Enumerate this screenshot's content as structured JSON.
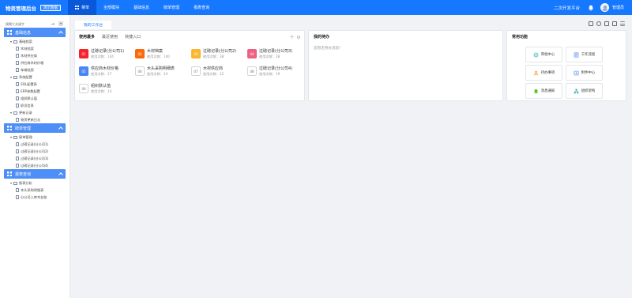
{
  "header": {
    "brand": "物资管理后台",
    "demo_tag": "演示数据",
    "nav": [
      {
        "label": "菜单",
        "active": true
      },
      {
        "label": "全部模块",
        "active": false
      },
      {
        "label": "基础信息",
        "active": false
      },
      {
        "label": "磅单管理",
        "active": false
      },
      {
        "label": "报表查询",
        "active": false
      }
    ],
    "platform_link": "二次开发平台",
    "username": "管理员"
  },
  "sidebar": {
    "search_placeholder": "模糊大关键字",
    "groups": [
      {
        "label": "基础信息",
        "nodes": [
          {
            "label": "基础档案",
            "level": 1,
            "type": "folder"
          },
          {
            "label": "木材档案",
            "level": 2,
            "type": "doc"
          },
          {
            "label": "木材供应商",
            "level": 2,
            "type": "doc"
          },
          {
            "label": "供应商木材价格",
            "level": 2,
            "type": "doc"
          },
          {
            "label": "车辆档案",
            "level": 2,
            "type": "doc"
          },
          {
            "label": "系统配置",
            "level": 1,
            "type": "folder"
          },
          {
            "label": "SQL配置表",
            "level": 2,
            "type": "doc"
          },
          {
            "label": "ERP参数配置",
            "level": 2,
            "type": "doc"
          },
          {
            "label": "组织默认值",
            "level": 2,
            "type": "doc"
          },
          {
            "label": "职员信息",
            "level": 2,
            "type": "doc"
          },
          {
            "label": "更新记录",
            "level": 1,
            "type": "folder"
          },
          {
            "label": "物资更新日志",
            "level": 2,
            "type": "doc"
          }
        ]
      },
      {
        "label": "磅单管理",
        "nodes": [
          {
            "label": "磅单管理",
            "level": 1,
            "type": "folder"
          },
          {
            "label": "过磅记录(分公司1)",
            "level": 2,
            "type": "doc"
          },
          {
            "label": "过磅记录(分公司2)",
            "level": 2,
            "type": "doc"
          },
          {
            "label": "过磅记录(分公司3)",
            "level": 2,
            "type": "doc"
          },
          {
            "label": "过磅记录(分公司4)",
            "level": 2,
            "type": "doc"
          }
        ]
      },
      {
        "label": "报表查询",
        "nodes": [
          {
            "label": "报表分析",
            "level": 1,
            "type": "folder"
          },
          {
            "label": "木头采购明细表",
            "level": 2,
            "type": "doc"
          },
          {
            "label": "分公司入库木台账",
            "level": 2,
            "type": "doc"
          }
        ]
      }
    ]
  },
  "workspace": {
    "tab": "我的工作台",
    "frequent": {
      "tabs": [
        {
          "label": "使用最多",
          "active": true
        },
        {
          "label": "最近使用",
          "active": false
        },
        {
          "label": "快捷入口",
          "active": false
        }
      ],
      "tiles": [
        {
          "num": "01",
          "name": "过磅记录(分公司1)",
          "usage": "使用次数：144",
          "color": "#f5222d",
          "outline": false
        },
        {
          "num": "02",
          "name": "木材档案",
          "usage": "使用次数：100",
          "color": "#fa6a0a",
          "outline": false
        },
        {
          "num": "03",
          "name": "过磅记录(分公司2)",
          "usage": "使用次数：38",
          "color": "#fab72d",
          "outline": false
        },
        {
          "num": "04",
          "name": "过磅记录(分公司3)",
          "usage": "使用次数：28",
          "color": "#ee6080",
          "outline": false
        },
        {
          "num": "05",
          "name": "供应商木材价格",
          "usage": "使用次数：27",
          "color": "#4a86f5",
          "outline": false
        },
        {
          "num": "06",
          "name": "木头采购明细表",
          "usage": "使用次数：24",
          "color": "#ffffff",
          "outline": true
        },
        {
          "num": "07",
          "name": "木材供应商",
          "usage": "使用次数：22",
          "color": "#ffffff",
          "outline": true
        },
        {
          "num": "08",
          "name": "过磅记录(分公司4)",
          "usage": "使用次数：19",
          "color": "#ffffff",
          "outline": true
        },
        {
          "num": "09",
          "name": "组织默认值",
          "usage": "使用次数：14",
          "color": "#ffffff",
          "outline": true
        }
      ]
    },
    "todo": {
      "title": "我的待办",
      "empty_text": "您暂无待办消息!"
    },
    "common": {
      "title": "常用功能",
      "items": [
        {
          "label": "审批中心",
          "icon": "approval-icon",
          "color": "#20b2aa"
        },
        {
          "label": "工作流程",
          "icon": "workflow-icon",
          "color": "#4a86f5"
        },
        {
          "label": "待办事项",
          "icon": "todo-icon",
          "color": "#fa8c16"
        },
        {
          "label": "附件中心",
          "icon": "attachment-icon",
          "color": "#4a86f5"
        },
        {
          "label": "消息通知",
          "icon": "notification-icon",
          "color": "#52c41a"
        },
        {
          "label": "组织架构",
          "icon": "org-chart-icon",
          "color": "#13a8a8"
        }
      ]
    }
  }
}
